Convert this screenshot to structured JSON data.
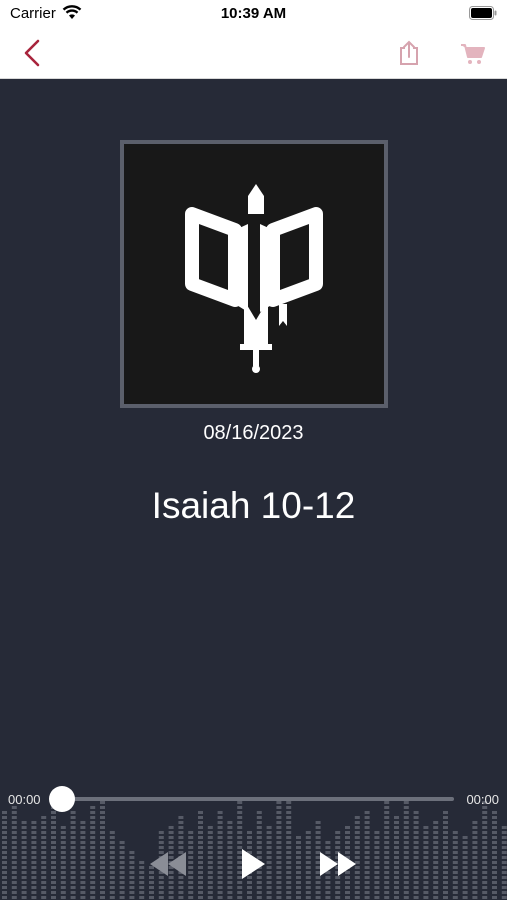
{
  "status_bar": {
    "carrier": "Carrier",
    "time": "10:39 AM"
  },
  "nav": {
    "back_icon": "chevron-left-icon",
    "share_icon": "share-icon",
    "cart_icon": "cart-icon",
    "accent_color": "#a8243c"
  },
  "episode": {
    "date": "08/16/2023",
    "title": "Isaiah 10-12",
    "artwork_icon": "bible-sword-icon"
  },
  "player": {
    "elapsed": "00:00",
    "remaining": "00:00",
    "progress": 0
  }
}
